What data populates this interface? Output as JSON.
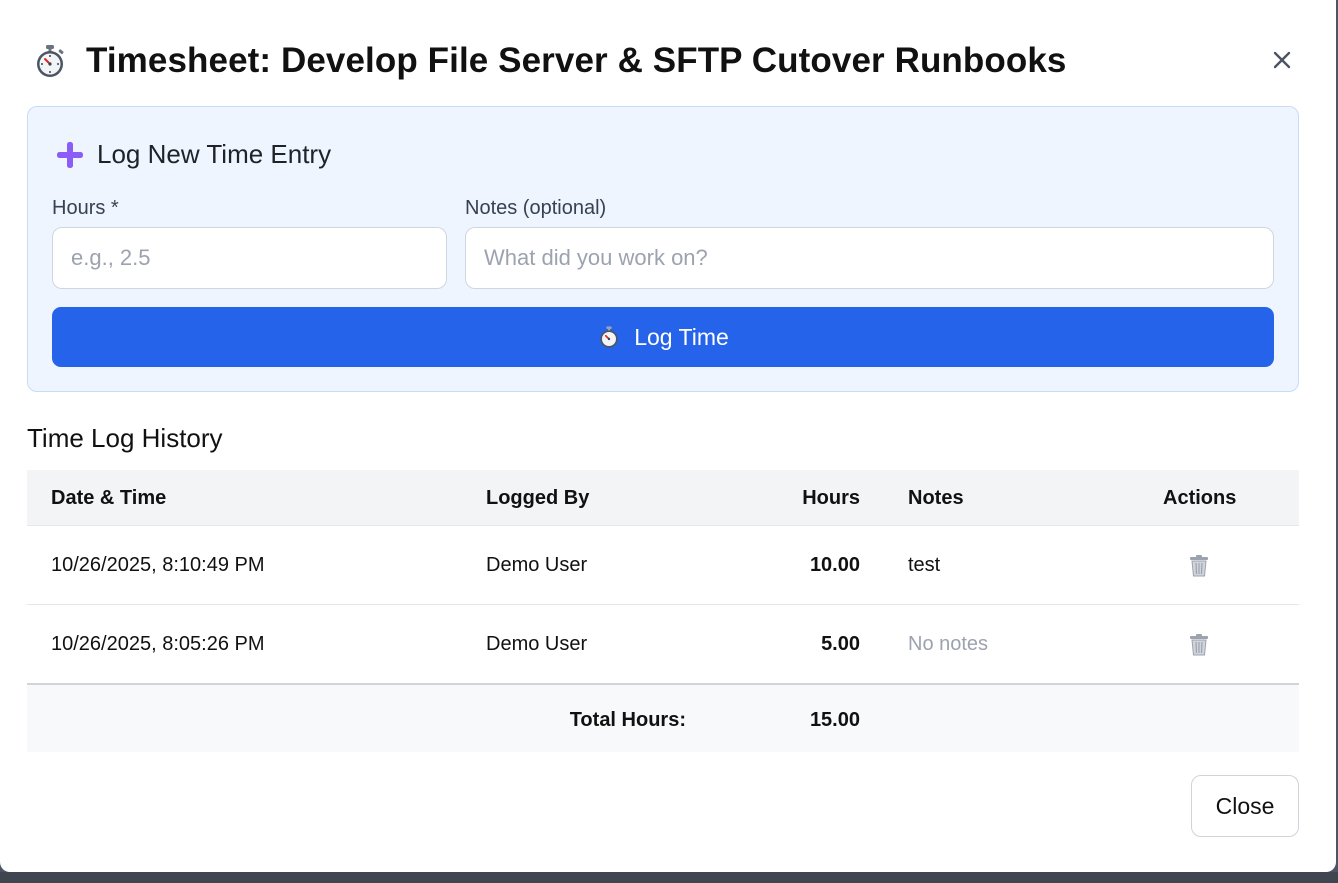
{
  "modal": {
    "title": "Timesheet: Develop File Server & SFTP Cutover Runbooks",
    "title_icon": "stopwatch-icon",
    "close_icon": "close-icon"
  },
  "log_form": {
    "heading": "Log New Time Entry",
    "heading_icon": "plus-icon",
    "hours_label": "Hours *",
    "hours_placeholder": "e.g., 2.5",
    "hours_value": "",
    "notes_label": "Notes (optional)",
    "notes_placeholder": "What did you work on?",
    "notes_value": "",
    "submit_label": "Log Time",
    "submit_icon": "stopwatch-icon"
  },
  "history": {
    "title": "Time Log History",
    "columns": [
      "Date & Time",
      "Logged By",
      "Hours",
      "Notes",
      "Actions"
    ],
    "rows": [
      {
        "datetime": "10/26/2025, 8:10:49 PM",
        "logged_by": "Demo User",
        "hours": "10.00",
        "notes": "test",
        "action_icon": "trash-icon"
      },
      {
        "datetime": "10/26/2025, 8:05:26 PM",
        "logged_by": "Demo User",
        "hours": "5.00",
        "notes": "No notes",
        "action_icon": "trash-icon"
      }
    ],
    "total_label": "Total Hours:",
    "total_value": "15.00"
  },
  "footer": {
    "close_label": "Close"
  },
  "colors": {
    "primary": "#2563eb",
    "panel_bg": "#eef5ff",
    "muted_text": "#9ca3af"
  }
}
